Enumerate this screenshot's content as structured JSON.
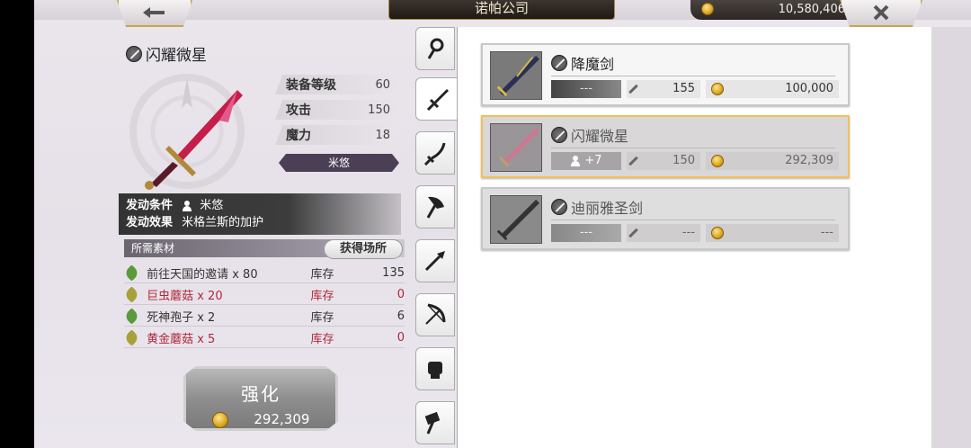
{
  "header": {
    "title": "诺帕公司",
    "gold": "10,580,406"
  },
  "weapon": {
    "name": "闪耀微星",
    "stats": [
      {
        "label": "装备等级",
        "value": "60"
      },
      {
        "label": "攻击",
        "value": "150"
      },
      {
        "label": "魔力",
        "value": "18"
      }
    ],
    "owner": "米悠",
    "condition_label": "发动条件",
    "condition_value": "米悠",
    "effect_label": "发动效果",
    "effect_value": "米格兰斯的加护"
  },
  "materials": {
    "header": "所需素材",
    "get_button": "获得场所",
    "items": [
      {
        "name": "前往天国的邀请 x 80",
        "stock_label": "库存",
        "qty": "135"
      },
      {
        "name": "巨虫蘑菇 x 20",
        "stock_label": "库存",
        "qty": "0"
      },
      {
        "name": "死神孢子 x 2",
        "stock_label": "库存",
        "qty": "6"
      },
      {
        "name": "黄金蘑菇 x 5",
        "stock_label": "库存",
        "qty": "0"
      }
    ]
  },
  "enhance": {
    "label": "强化",
    "cost": "292,309"
  },
  "tabs": [
    "staff-icon",
    "sword-icon",
    "katana-icon",
    "axe-icon",
    "spear-icon",
    "bow-icon",
    "fist-icon",
    "hammer-icon"
  ],
  "list": [
    {
      "name": "降魔剑",
      "col1": "---",
      "attack": "155",
      "price": "100,000"
    },
    {
      "name": "闪耀微星",
      "col1": "+7",
      "attack": "150",
      "price": "292,309"
    },
    {
      "name": "迪丽雅圣剑",
      "col1": "---",
      "attack": "---",
      "price": "---"
    }
  ],
  "colors": {
    "accent_gold": "#c9a64a",
    "shortage_red": "#b0283a",
    "selected_border": "#f0c15a"
  }
}
